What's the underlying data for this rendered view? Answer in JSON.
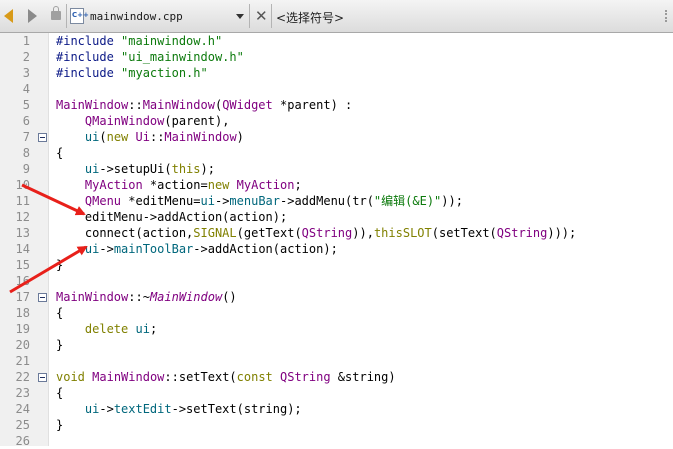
{
  "toolbar": {
    "file_name": "mainwindow.cpp",
    "file_icon_text": "C++",
    "symbol_placeholder": "<选择符号>"
  },
  "gutter": {
    "line_numbers": [
      "1",
      "2",
      "3",
      "4",
      "5",
      "6",
      "7",
      "8",
      "9",
      "10",
      "11",
      "12",
      "13",
      "14",
      "15",
      "16",
      "17",
      "18",
      "19",
      "20",
      "21",
      "22",
      "23",
      "24",
      "25",
      "26"
    ]
  },
  "code": {
    "l1": {
      "a": "#include ",
      "b": "\"mainwindow.h\""
    },
    "l2": {
      "a": "#include ",
      "b": "\"ui_mainwindow.h\""
    },
    "l3": {
      "a": "#include ",
      "b": "\"myaction.h\""
    },
    "l5": {
      "a": "MainWindow",
      "b": "::",
      "c": "MainWindow",
      "d": "(",
      "e": "QWidget",
      "f": " *parent) :"
    },
    "l6": {
      "a": "    ",
      "b": "QMainWindow",
      "c": "(parent),"
    },
    "l7": {
      "a": "    ",
      "b": "ui",
      "c": "(",
      "d": "new",
      "e": " ",
      "f": "Ui",
      "g": "::",
      "h": "MainWindow",
      "i": ")"
    },
    "l8": {
      "a": "{"
    },
    "l9": {
      "a": "    ",
      "b": "ui",
      "c": "->setupUi(",
      "d": "this",
      "e": ");"
    },
    "l10": {
      "a": "    ",
      "b": "MyAction",
      "c": " *action=",
      "d": "new",
      "e": " ",
      "f": "MyAction",
      "g": ";"
    },
    "l11": {
      "a": "    ",
      "b": "QMenu",
      "c": " *editMenu=",
      "d": "ui",
      "e": "->",
      "f": "menuBar",
      "g": "->addMenu(tr(",
      "h": "\"编辑(&E)\"",
      "i": "));"
    },
    "l12": {
      "a": "    editMenu->addAction(action);"
    },
    "l13": {
      "a": "    connect(action,",
      "b": "SIGNAL",
      "c": "(getText(",
      "d": "QString",
      "e": ")),",
      "f": "this",
      ",g": ",",
      "h": "SLOT",
      "i": "(setText(",
      "j": "QString",
      "k": ")));"
    },
    "l14": {
      "a": "    ",
      "b": "ui",
      "c": "->",
      "d": "mainToolBar",
      "e": "->addAction(action);"
    },
    "l15": {
      "a": "}"
    },
    "l17": {
      "a": "MainWindow",
      "b": "::~",
      "c": "MainWindow",
      "d": "()"
    },
    "l18": {
      "a": "{"
    },
    "l19": {
      "a": "    ",
      "b": "delete",
      "c": " ",
      "d": "ui",
      ";": ";"
    },
    "l20": {
      "a": "}"
    },
    "l22": {
      "a": "void",
      "b": " ",
      "c": "MainWindow",
      "d": "::setText(",
      "e": "const",
      "f": " ",
      "g": "QString",
      "h": " &string)"
    },
    "l23": {
      "a": "{"
    },
    "l24": {
      "a": "    ",
      "b": "ui",
      "c": "->",
      "d": "textEdit",
      "e": "->setText(string);"
    },
    "l25": {
      "a": "}"
    }
  },
  "colors": {
    "preprocessor": "#0c1a87",
    "string": "#0c7a0c",
    "keyword": "#808000",
    "type": "#800080",
    "member": "#00677c",
    "annotation_arrow": "#e8201a"
  }
}
